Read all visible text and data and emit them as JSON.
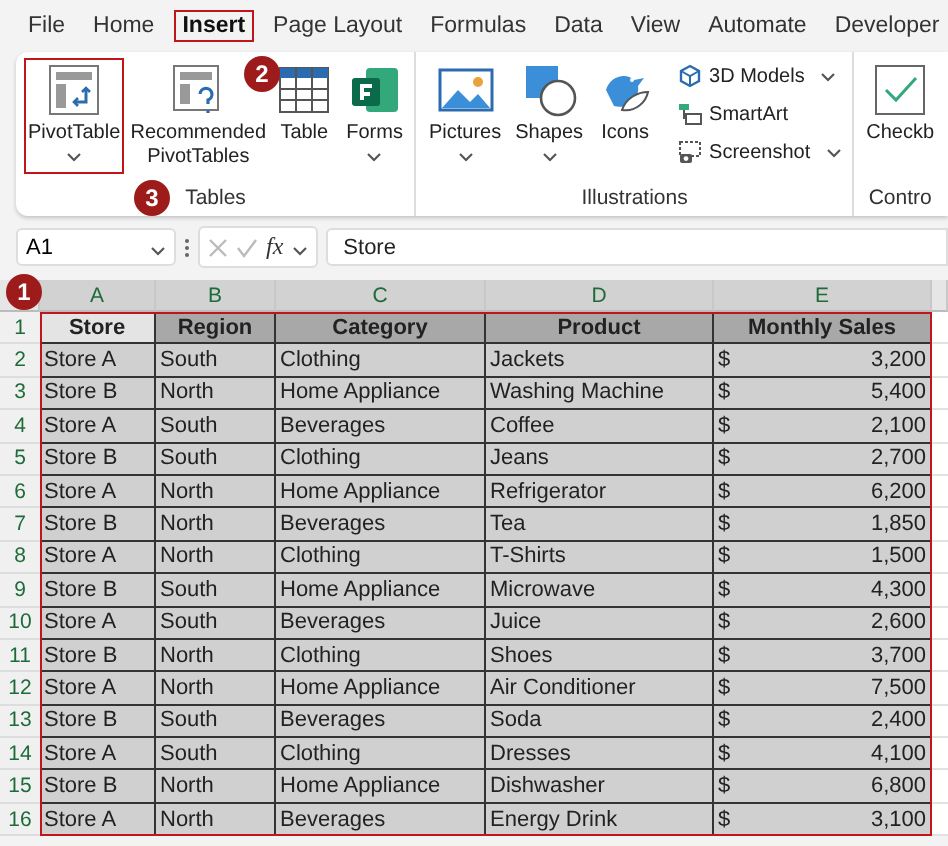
{
  "menu_tabs": [
    {
      "label": "File",
      "selected": false,
      "highlighted": false
    },
    {
      "label": "Home",
      "selected": false,
      "highlighted": false
    },
    {
      "label": "Insert",
      "selected": true,
      "highlighted": true
    },
    {
      "label": "Page Layout",
      "selected": false,
      "highlighted": false
    },
    {
      "label": "Formulas",
      "selected": false,
      "highlighted": false
    },
    {
      "label": "Data",
      "selected": false,
      "highlighted": false
    },
    {
      "label": "View",
      "selected": false,
      "highlighted": false
    },
    {
      "label": "Automate",
      "selected": false,
      "highlighted": false
    },
    {
      "label": "Developer",
      "selected": false,
      "highlighted": false
    }
  ],
  "ribbon": {
    "groups": [
      {
        "label": "Tables",
        "buttons": [
          {
            "kind": "large",
            "label": "PivotTable",
            "dropdown": true,
            "highlighted": true
          },
          {
            "kind": "large",
            "label": "Recommended PivotTables",
            "dropdown": false,
            "highlighted": false
          },
          {
            "kind": "large",
            "label": "Table",
            "dropdown": false,
            "highlighted": false
          },
          {
            "kind": "large",
            "label": "Forms",
            "dropdown": true,
            "highlighted": false
          }
        ]
      },
      {
        "label": "Illustrations",
        "buttons": [
          {
            "kind": "large",
            "label": "Pictures",
            "dropdown": true,
            "highlighted": false
          },
          {
            "kind": "large",
            "label": "Shapes",
            "dropdown": true,
            "highlighted": false
          },
          {
            "kind": "large",
            "label": "Icons",
            "dropdown": false,
            "highlighted": false
          },
          {
            "kind": "small",
            "label": "3D Models",
            "dropdown": true,
            "highlighted": false
          },
          {
            "kind": "small",
            "label": "SmartArt",
            "dropdown": false,
            "highlighted": false
          },
          {
            "kind": "small",
            "label": "Screenshot",
            "dropdown": true,
            "highlighted": false
          }
        ]
      },
      {
        "label": "Contro",
        "buttons": [
          {
            "kind": "large",
            "label": "Checkb",
            "dropdown": false,
            "highlighted": false
          }
        ]
      }
    ]
  },
  "callouts": [
    "1",
    "2",
    "3"
  ],
  "formula_bar": {
    "name_box": "A1",
    "function_label": "fx",
    "formula": "Store"
  },
  "sheet": {
    "highlighted": true,
    "columns": [
      {
        "label": "A",
        "selected": true
      },
      {
        "label": "B",
        "selected": true
      },
      {
        "label": "C",
        "selected": true
      },
      {
        "label": "D",
        "selected": true
      },
      {
        "label": "E",
        "selected": true
      }
    ],
    "header": {
      "row": "1",
      "cells": [
        {
          "text": "Store",
          "active": true
        },
        {
          "text": "Region",
          "active": false
        },
        {
          "text": "Category",
          "active": false
        },
        {
          "text": "Product",
          "active": false
        },
        {
          "text": "Monthly Sales",
          "active": false
        }
      ]
    },
    "rows": [
      {
        "row": "2",
        "cells": [
          "Store A",
          "South",
          "Clothing",
          "Jackets"
        ],
        "currency": "$",
        "amount": "3,200"
      },
      {
        "row": "3",
        "cells": [
          "Store B",
          "North",
          "Home Appliance",
          "Washing Machine"
        ],
        "currency": "$",
        "amount": "5,400"
      },
      {
        "row": "4",
        "cells": [
          "Store A",
          "South",
          "Beverages",
          "Coffee"
        ],
        "currency": "$",
        "amount": "2,100"
      },
      {
        "row": "5",
        "cells": [
          "Store B",
          "South",
          "Clothing",
          "Jeans"
        ],
        "currency": "$",
        "amount": "2,700"
      },
      {
        "row": "6",
        "cells": [
          "Store A",
          "North",
          "Home Appliance",
          "Refrigerator"
        ],
        "currency": "$",
        "amount": "6,200"
      },
      {
        "row": "7",
        "cells": [
          "Store B",
          "North",
          "Beverages",
          "Tea"
        ],
        "currency": "$",
        "amount": "1,850"
      },
      {
        "row": "8",
        "cells": [
          "Store A",
          "North",
          "Clothing",
          "T-Shirts"
        ],
        "currency": "$",
        "amount": "1,500"
      },
      {
        "row": "9",
        "cells": [
          "Store B",
          "South",
          "Home Appliance",
          "Microwave"
        ],
        "currency": "$",
        "amount": "4,300"
      },
      {
        "row": "10",
        "cells": [
          "Store A",
          "South",
          "Beverages",
          "Juice"
        ],
        "currency": "$",
        "amount": "2,600"
      },
      {
        "row": "11",
        "cells": [
          "Store B",
          "North",
          "Clothing",
          "Shoes"
        ],
        "currency": "$",
        "amount": "3,700"
      },
      {
        "row": "12",
        "cells": [
          "Store A",
          "North",
          "Home Appliance",
          "Air Conditioner"
        ],
        "currency": "$",
        "amount": "7,500"
      },
      {
        "row": "13",
        "cells": [
          "Store B",
          "South",
          "Beverages",
          "Soda"
        ],
        "currency": "$",
        "amount": "2,400"
      },
      {
        "row": "14",
        "cells": [
          "Store A",
          "South",
          "Clothing",
          "Dresses"
        ],
        "currency": "$",
        "amount": "4,100"
      },
      {
        "row": "15",
        "cells": [
          "Store B",
          "North",
          "Home Appliance",
          "Dishwasher"
        ],
        "currency": "$",
        "amount": "6,800"
      },
      {
        "row": "16",
        "cells": [
          "Store A",
          "North",
          "Beverages",
          "Energy Drink"
        ],
        "currency": "$",
        "amount": "3,100"
      }
    ]
  }
}
